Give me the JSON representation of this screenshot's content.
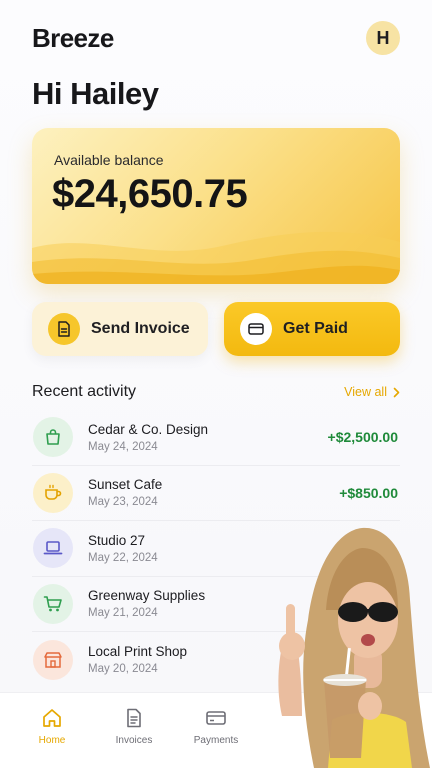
{
  "app": {
    "brand": "Breeze",
    "avatar_initial": "H"
  },
  "greeting": "Hi Hailey",
  "balance": {
    "label": "Available balance",
    "amount": "$24,650.75"
  },
  "actions": [
    {
      "label": "Send Invoice",
      "icon": "document-icon"
    },
    {
      "label": "Get Paid",
      "icon": "card-icon"
    }
  ],
  "recent": {
    "title": "Recent activity",
    "view_all": "View all",
    "items": [
      {
        "name": "Cedar & Co. Design",
        "date": "May 24, 2024",
        "amount": "+$2,500.00",
        "icon": "bag-icon",
        "icon_color": "#2f9e4f",
        "icon_bg": "#e3f3e6"
      },
      {
        "name": "Sunset Cafe",
        "date": "May 23, 2024",
        "amount": "+$850.00",
        "icon": "cup-icon",
        "icon_color": "#e3a200",
        "icon_bg": "#fcf0c9"
      },
      {
        "name": "Studio 27",
        "date": "May 22, 2024",
        "amount": "",
        "icon": "laptop-icon",
        "icon_color": "#5a58c8",
        "icon_bg": "#e6e6f8"
      },
      {
        "name": "Greenway Supplies",
        "date": "May 21, 2024",
        "amount": "",
        "icon": "cart-icon",
        "icon_color": "#2f9e4f",
        "icon_bg": "#e3f3e6"
      },
      {
        "name": "Local Print Shop",
        "date": "May 20, 2024",
        "amount": "",
        "icon": "shop-icon",
        "icon_color": "#e46a3c",
        "icon_bg": "#fbe6dc"
      }
    ]
  },
  "nav": [
    {
      "label": "Home",
      "icon": "home-icon",
      "active": true
    },
    {
      "label": "Invoices",
      "icon": "invoice-icon",
      "active": false
    },
    {
      "label": "Payments",
      "icon": "card-icon",
      "active": false
    }
  ],
  "colors": {
    "accent": "#f5bd1c",
    "positive": "#1f8a3a",
    "active_nav": "#e6a800"
  }
}
